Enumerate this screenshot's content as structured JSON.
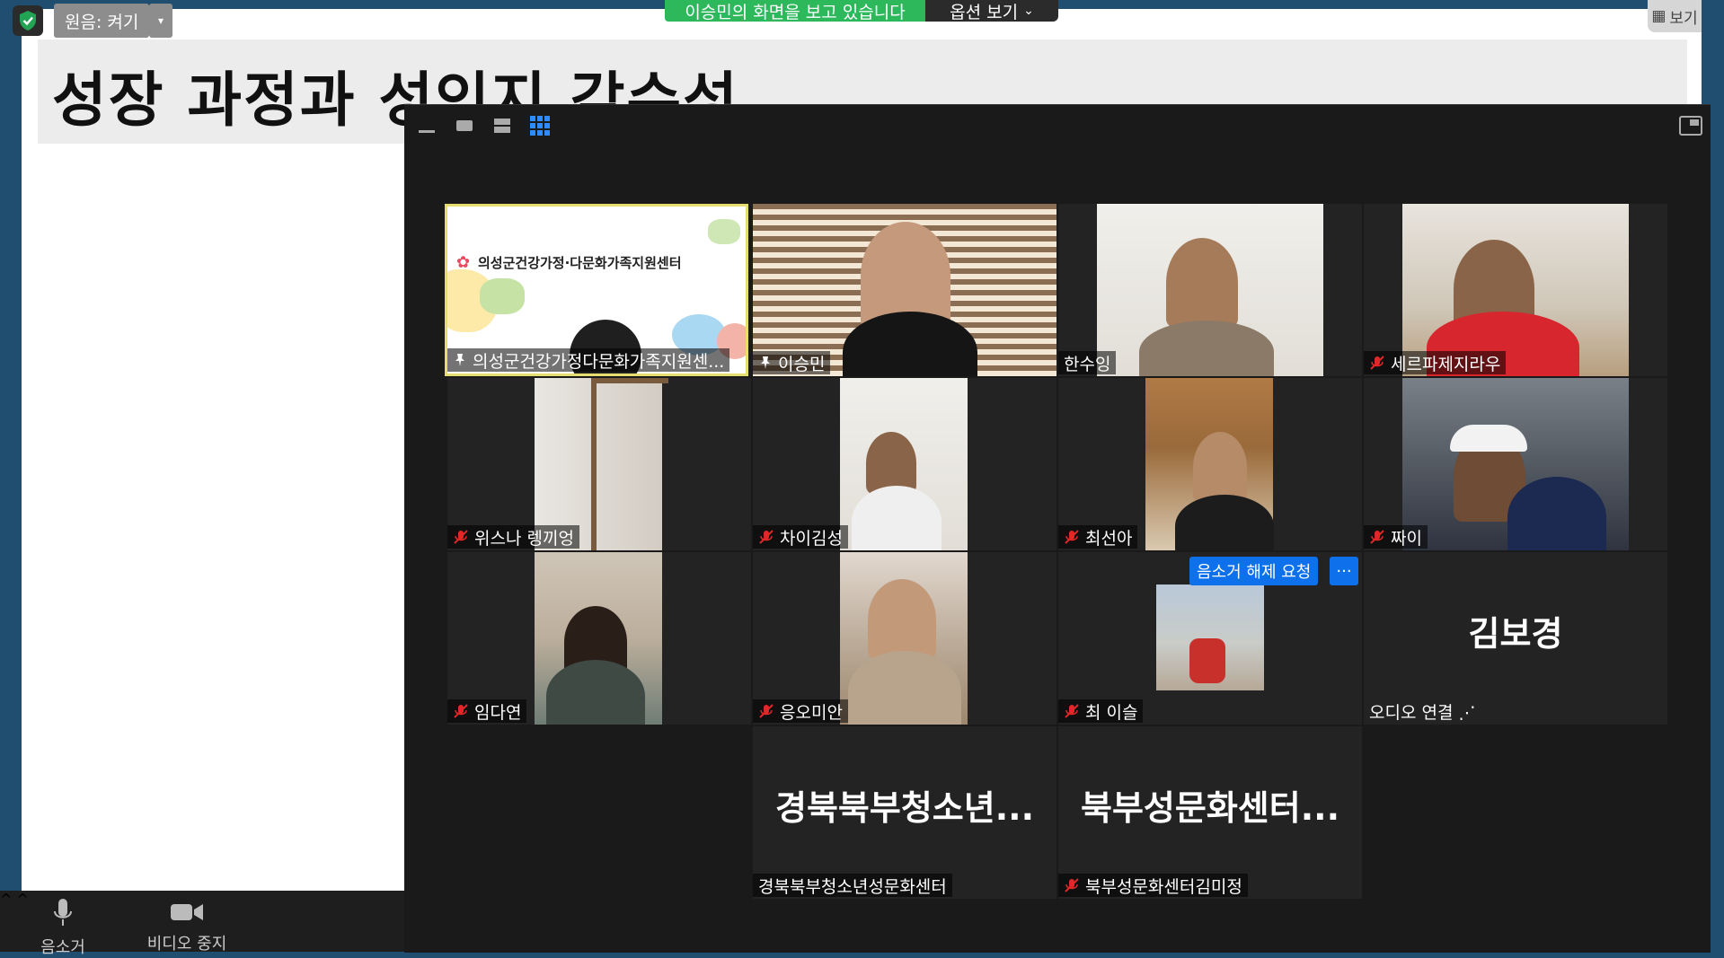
{
  "slide": {
    "title": "성장 과정과 성인지 감수성"
  },
  "top_controls": {
    "original_sound": "원음: 켜기",
    "share_banner": "이승민의 화면을 보고 있습니다",
    "view_options": "옵션 보기",
    "view": "보기"
  },
  "toolbar": {
    "mute_label": "음소거",
    "video_label": "비디오 중지"
  },
  "gallery": {
    "unmute_request": "음소거 해제 요청",
    "more": "···",
    "participants": [
      {
        "name": "의성군건강가정다문화가족지원센...",
        "logo_text": "의성군건강가정·다문화가족지원센터",
        "muted": false,
        "pinned": true,
        "active": true
      },
      {
        "name": "이승민",
        "muted": false,
        "pinned": true
      },
      {
        "name": "한수잉",
        "muted": false
      },
      {
        "name": "세르파제지라우",
        "muted": true
      },
      {
        "name": "위스나 렝끼엉",
        "muted": true
      },
      {
        "name": "차이김성",
        "muted": true
      },
      {
        "name": "최선아",
        "muted": true
      },
      {
        "name": "짜이",
        "muted": true
      },
      {
        "name": "임다연",
        "muted": true
      },
      {
        "name": "응오미안",
        "muted": true
      },
      {
        "name": "최 이슬",
        "muted": true
      },
      {
        "name": "오디오 연결 ⋰",
        "big_name": "김보경",
        "muted": false
      },
      {
        "name": "경북북부청소년성문화센터",
        "big_name": "경북북부청소년...",
        "muted": false
      },
      {
        "name": "북부성문화센터김미정",
        "big_name": "북부성문화센터...",
        "muted": true
      }
    ]
  },
  "colors": {
    "banner_green": "#2eb85c",
    "active_border": "#e6dd6f",
    "mute_red": "#e02828",
    "request_blue": "#0e71eb"
  }
}
